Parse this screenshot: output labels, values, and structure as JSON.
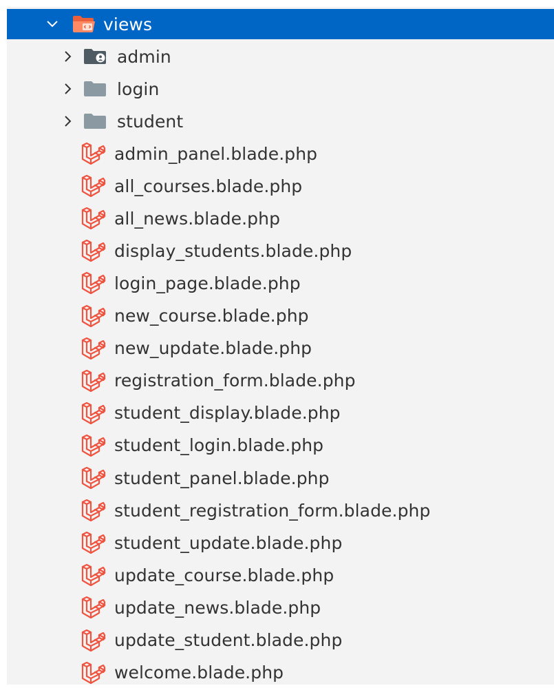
{
  "tree": {
    "root": {
      "label": "views",
      "expanded": true,
      "selected": true,
      "icon": "folder-views-open-icon",
      "accent": "#0066c6"
    },
    "folders": [
      {
        "label": "admin",
        "icon": "folder-admin-icon"
      },
      {
        "label": "login",
        "icon": "folder-icon"
      },
      {
        "label": "student",
        "icon": "folder-icon"
      }
    ],
    "files": [
      {
        "label": "admin_panel.blade.php"
      },
      {
        "label": "all_courses.blade.php"
      },
      {
        "label": "all_news.blade.php"
      },
      {
        "label": "display_students.blade.php"
      },
      {
        "label": "login_page.blade.php"
      },
      {
        "label": "new_course.blade.php"
      },
      {
        "label": "new_update.blade.php"
      },
      {
        "label": "registration_form.blade.php"
      },
      {
        "label": "student_display.blade.php"
      },
      {
        "label": "student_login.blade.php"
      },
      {
        "label": "student_panel.blade.php"
      },
      {
        "label": "student_registration_form.blade.php"
      },
      {
        "label": "student_update.blade.php"
      },
      {
        "label": "update_course.blade.php"
      },
      {
        "label": "update_news.blade.php"
      },
      {
        "label": "update_student.blade.php"
      },
      {
        "label": "welcome.blade.php"
      }
    ],
    "file_icon": "laravel-icon",
    "file_icon_color": "#f0533f",
    "folder_icon_color": "#8b9aa2"
  }
}
